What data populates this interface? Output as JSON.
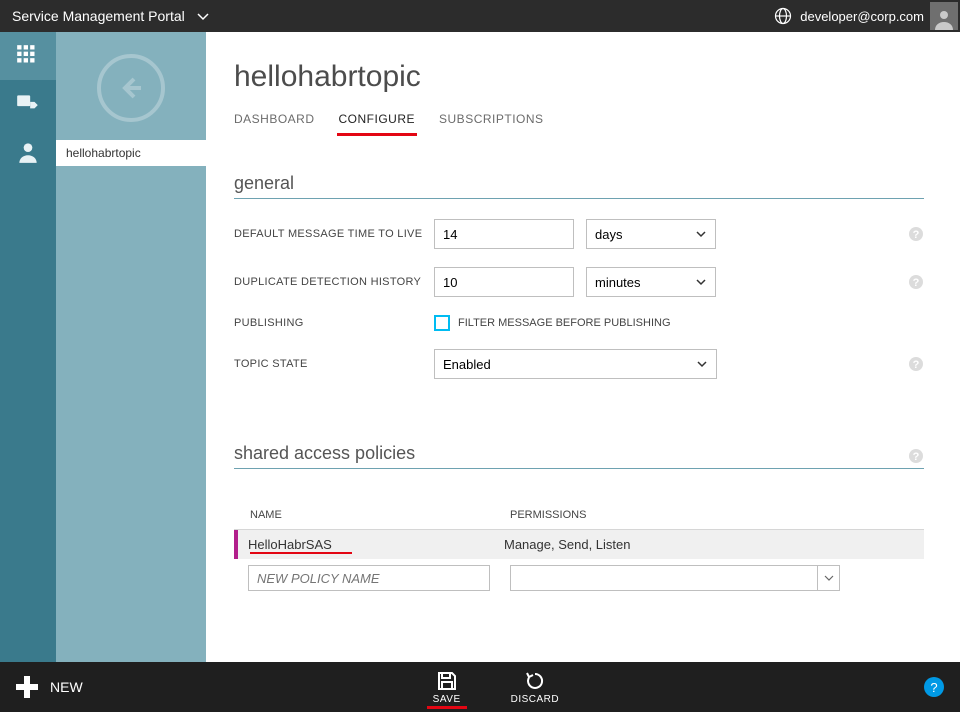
{
  "header": {
    "brand": "Service Management Portal",
    "user": "developer@corp.com"
  },
  "sidepanel": {
    "item": "hellohabrtopic"
  },
  "page": {
    "title": "hellohabrtopic",
    "tabs": [
      "DASHBOARD",
      "CONFIGURE",
      "SUBSCRIPTIONS"
    ],
    "active_tab": 1
  },
  "general": {
    "title": "general",
    "ttl_label": "DEFAULT MESSAGE TIME TO LIVE",
    "ttl_value": "14",
    "ttl_unit": "days",
    "dup_label": "DUPLICATE DETECTION HISTORY",
    "dup_value": "10",
    "dup_unit": "minutes",
    "pub_label": "PUBLISHING",
    "pub_cb_label": "FILTER MESSAGE BEFORE PUBLISHING",
    "state_label": "TOPIC STATE",
    "state_value": "Enabled"
  },
  "sap": {
    "title": "shared access policies",
    "col_name": "NAME",
    "col_perm": "PERMISSIONS",
    "row_name": "HelloHabrSAS",
    "row_perm": "Manage, Send, Listen",
    "new_placeholder": "NEW POLICY NAME"
  },
  "bottom": {
    "new": "NEW",
    "save": "SAVE",
    "discard": "DISCARD"
  }
}
